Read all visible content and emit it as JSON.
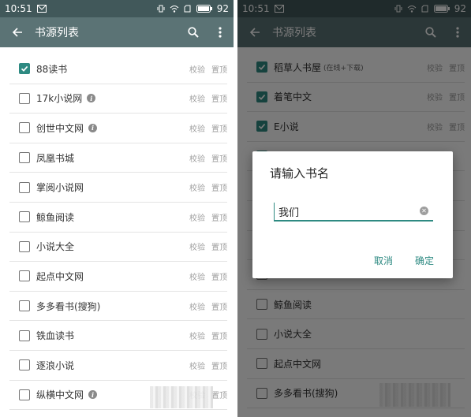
{
  "status_bar": {
    "time": "10:51",
    "battery": "92"
  },
  "toolbar": {
    "title": "书源列表"
  },
  "actions": {
    "verify": "校验",
    "pin": "置顶"
  },
  "left_list": [
    {
      "name": "88读书",
      "checked": true,
      "info": false
    },
    {
      "name": "17k小说网",
      "checked": false,
      "info": true
    },
    {
      "name": "创世中文网",
      "checked": false,
      "info": true
    },
    {
      "name": "凤凰书城",
      "checked": false,
      "info": false
    },
    {
      "name": "掌阅小说网",
      "checked": false,
      "info": false
    },
    {
      "name": "鲸鱼阅读",
      "checked": false,
      "info": false
    },
    {
      "name": "小说大全",
      "checked": false,
      "info": false
    },
    {
      "name": "起点中文网",
      "checked": false,
      "info": false
    },
    {
      "name": "多多看书(搜狗)",
      "checked": false,
      "info": false
    },
    {
      "name": "铁血读书",
      "checked": false,
      "info": false
    },
    {
      "name": "逐浪小说",
      "checked": false,
      "info": false
    },
    {
      "name": "纵横中文网",
      "checked": false,
      "info": true
    }
  ],
  "right_list": [
    {
      "name": "稻草人书屋",
      "sub": "(在线+下载)",
      "checked": true
    },
    {
      "name": "着笔中文",
      "sub": "",
      "checked": true
    },
    {
      "name": "E小说",
      "sub": "",
      "checked": true
    },
    {
      "name": "",
      "sub": "",
      "checked": true
    },
    {
      "name": "",
      "sub": "",
      "checked": false
    },
    {
      "name": "",
      "sub": "",
      "checked": false
    },
    {
      "name": "",
      "sub": "",
      "checked": false
    },
    {
      "name": "",
      "sub": "",
      "checked": false
    },
    {
      "name": "鲸鱼阅读",
      "sub": "",
      "checked": false
    },
    {
      "name": "小说大全",
      "sub": "",
      "checked": false
    },
    {
      "name": "起点中文网",
      "sub": "",
      "checked": false
    },
    {
      "name": "多多看书(搜狗)",
      "sub": "",
      "checked": false
    }
  ],
  "dialog": {
    "title": "请输入书名",
    "input_value": "我们",
    "cancel_label": "取消",
    "ok_label": "确定"
  },
  "colors": {
    "accent": "#2e8a82",
    "toolbar": "#5b7375",
    "statusbar": "#41585a"
  },
  "icons": [
    "back-arrow-icon",
    "search-icon",
    "more-vert-icon",
    "checkmark-icon",
    "info-icon",
    "clear-icon"
  ]
}
